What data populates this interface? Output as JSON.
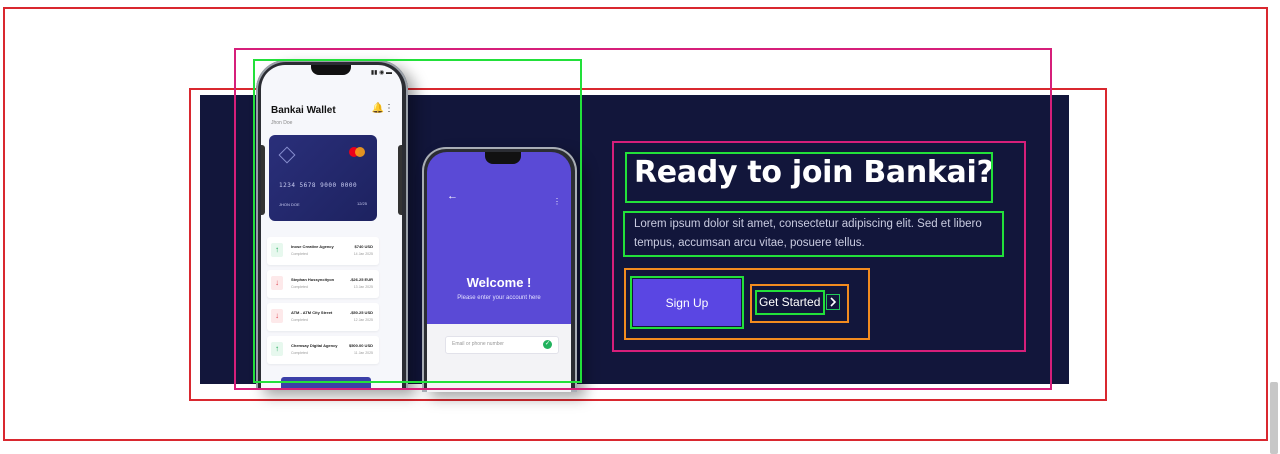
{
  "cta": {
    "heading": "Ready to join Bankai?",
    "description": "Lorem ipsum dolor sit amet, consectetur adipiscing elit. Sed et libero tempus, accumsan arcu vitae, posuere tellus.",
    "signup_label": "Sign Up",
    "getstarted_label": "Get Started",
    "getstarted_icon": "chevron-right-icon"
  },
  "wallet_phone": {
    "title": "Bankai Wallet",
    "subtitle": "Jhon Doe",
    "card_number": "1234 5678 9000 0000",
    "card_holder": "JHON DOE",
    "card_expiry": "12/25",
    "transactions": [
      {
        "name": "Inose Creative Agency",
        "status": "Completed",
        "amount": "$740 USD",
        "date": "14 Jan 2025",
        "direction": "up"
      },
      {
        "name": "Stephan Hussyncityon",
        "status": "Completed",
        "amount": "-$26.25 EUR",
        "date": "13 Jan 2025",
        "direction": "down"
      },
      {
        "name": "ATM - ATM City Street",
        "status": "Completed",
        "amount": "-$50.25 USD",
        "date": "12 Jan 2025",
        "direction": "down"
      },
      {
        "name": "Chemsay Digital Agency",
        "status": "Completed",
        "amount": "$500.00 USD",
        "date": "11 Jan 2025",
        "direction": "up"
      }
    ]
  },
  "welcome_phone": {
    "title": "Welcome !",
    "subtitle": "Please enter your account here",
    "phone_placeholder": "Email or phone number"
  },
  "colors": {
    "card_bg": "#12163b",
    "accent": "#5a46e3",
    "heading": "#ffffff",
    "body_text": "#c9cbe0"
  }
}
